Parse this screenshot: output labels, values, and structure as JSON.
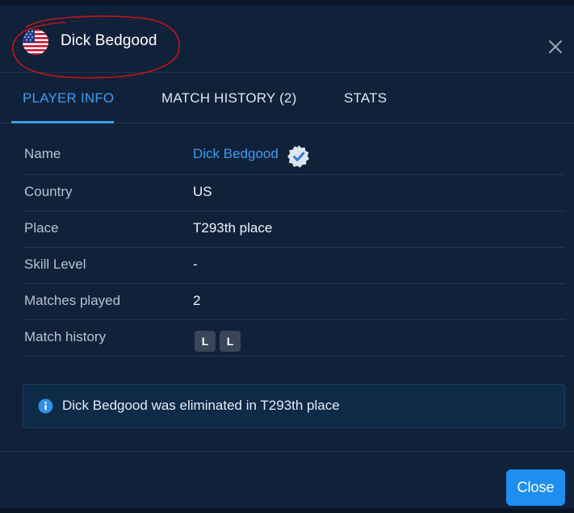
{
  "header": {
    "title": "Dick Bedgood",
    "flag_icon": "us-flag-icon",
    "close_icon": "close-icon"
  },
  "tabs": [
    {
      "label": "PLAYER INFO",
      "active": true
    },
    {
      "label": "MATCH HISTORY (2)",
      "active": false
    },
    {
      "label": "STATS",
      "active": false
    }
  ],
  "player_info": {
    "rows": [
      {
        "label": "Name",
        "value": "Dick Bedgood"
      },
      {
        "label": "Country",
        "value": "US"
      },
      {
        "label": "Place",
        "value": "T293th place"
      },
      {
        "label": "Skill Level",
        "value": "-"
      },
      {
        "label": "Matches played",
        "value": "2"
      },
      {
        "label": "Match history",
        "value": ""
      }
    ],
    "match_history_badges": [
      "L",
      "L"
    ],
    "verified_icon": "verified-badge-icon"
  },
  "info_message": "Dick Bedgood was eliminated in T293th place",
  "footer": {
    "close_label": "Close"
  },
  "colors": {
    "background": "#10213a",
    "accent": "#3d9ef0",
    "button": "#1f8ef1",
    "annotation": "#c0161c"
  }
}
